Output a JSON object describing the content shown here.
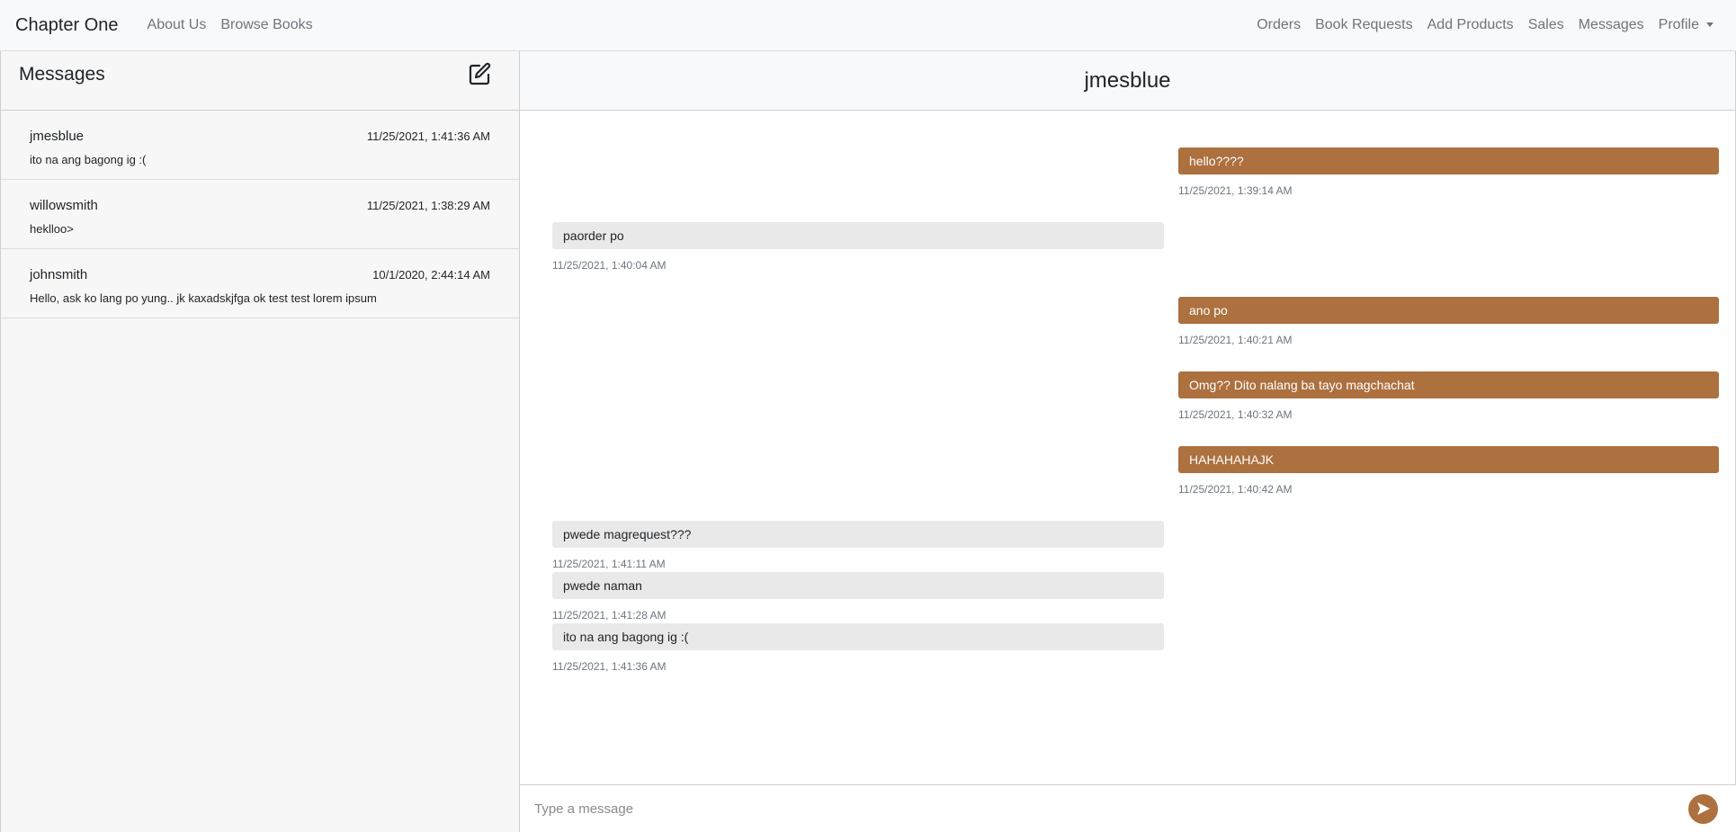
{
  "navbar": {
    "brand": "Chapter One",
    "left_links": [
      "About Us",
      "Browse Books"
    ],
    "right_links": [
      "Orders",
      "Book Requests",
      "Add Products",
      "Sales",
      "Messages"
    ],
    "profile_label": "Profile"
  },
  "sidebar": {
    "title": "Messages",
    "compose_icon": "compose-icon",
    "conversations": [
      {
        "name": "jmesblue",
        "time": "11/25/2021, 1:41:36 AM",
        "preview": "ito na ang bagong ig :("
      },
      {
        "name": "willowsmith",
        "time": "11/25/2021, 1:38:29 AM",
        "preview": "heklloo>"
      },
      {
        "name": "johnsmith",
        "time": "10/1/2020, 2:44:14 AM",
        "preview": "Hello, ask ko lang po yung.. jk kaxadskjfga ok test test lorem ipsum"
      }
    ]
  },
  "chat": {
    "title": "jmesblue",
    "messages": [
      {
        "dir": "out",
        "text": "hello????",
        "time": "11/25/2021, 1:39:14 AM"
      },
      {
        "dir": "in",
        "text": "paorder po",
        "time": "11/25/2021, 1:40:04 AM"
      },
      {
        "dir": "out",
        "text": "ano po",
        "time": "11/25/2021, 1:40:21 AM"
      },
      {
        "dir": "out",
        "text": "Omg?? Dito nalang ba tayo magchachat",
        "time": "11/25/2021, 1:40:32 AM"
      },
      {
        "dir": "out",
        "text": "HAHAHAHAJK",
        "time": "11/25/2021, 1:40:42 AM"
      },
      {
        "dir": "in",
        "text": "pwede magrequest???",
        "time": "11/25/2021, 1:41:11 AM"
      },
      {
        "dir": "in",
        "text": "pwede naman",
        "time": "11/25/2021, 1:41:28 AM"
      },
      {
        "dir": "in",
        "text": "ito na ang bagong ig :(",
        "time": "11/25/2021, 1:41:36 AM"
      }
    ],
    "composer_placeholder": "Type a message",
    "send_icon": "send-icon"
  },
  "colors": {
    "accent": "#ad703f",
    "incoming_bubble": "#e9e9e9",
    "navbar_bg": "#f8f9fa"
  }
}
